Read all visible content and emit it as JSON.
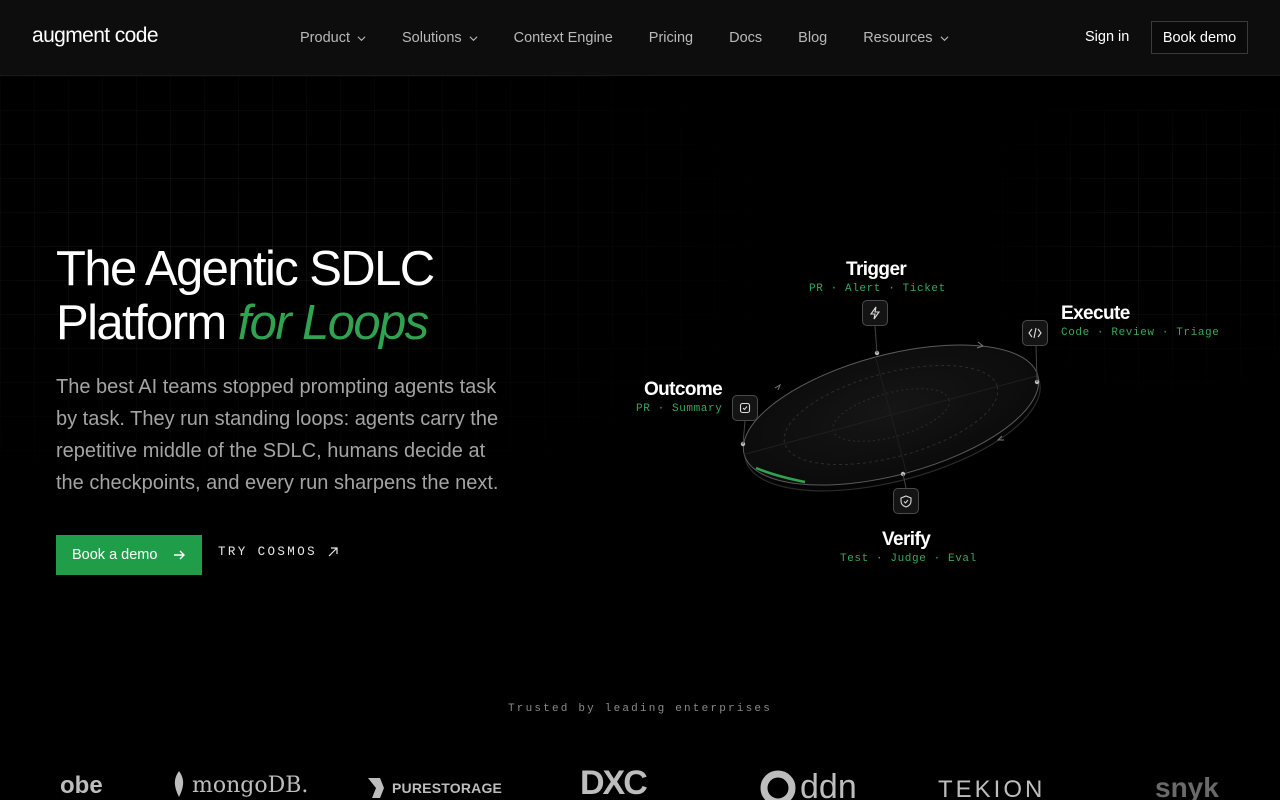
{
  "nav": {
    "brand": "augment code",
    "links": [
      {
        "label": "Product",
        "has_dropdown": true
      },
      {
        "label": "Solutions",
        "has_dropdown": true
      },
      {
        "label": "Context Engine",
        "has_dropdown": false
      },
      {
        "label": "Pricing",
        "has_dropdown": false
      },
      {
        "label": "Docs",
        "has_dropdown": false
      },
      {
        "label": "Blog",
        "has_dropdown": false
      },
      {
        "label": "Resources",
        "has_dropdown": true
      }
    ],
    "sign_in": "Sign in",
    "book_demo": "Book demo"
  },
  "hero": {
    "title_line1": "The Agentic SDLC",
    "title_line2_plain": "Platform",
    "title_line2_accent": "for Loops",
    "subtitle": "The best AI teams stopped prompting agents task by task. They run standing loops: agents carry the repetitive middle of the SDLC, humans decide at the checkpoints, and every run sharpens the next.",
    "cta_primary": "Book a demo",
    "cta_secondary": "TRY COSMOS"
  },
  "loop": {
    "trigger": {
      "title": "Trigger",
      "sub": "PR · Alert · Ticket",
      "icon": "lightning-icon"
    },
    "execute": {
      "title": "Execute",
      "sub": "Code · Review · Triage",
      "icon": "code-icon"
    },
    "verify": {
      "title": "Verify",
      "sub": "Test · Judge · Eval",
      "icon": "shield-icon"
    },
    "outcome": {
      "title": "Outcome",
      "sub": "PR · Summary",
      "icon": "outcome-icon"
    }
  },
  "trusted": {
    "heading": "Trusted by leading enterprises",
    "logos": [
      "obe",
      "mongoDB.",
      "PURESTORAGE",
      "DXC",
      "ddn",
      "TEKION",
      "snyk"
    ]
  },
  "colors": {
    "accent": "#1f9d49",
    "accent_text": "#2fa34f",
    "mono_green": "#35a85a",
    "background": "#000000"
  }
}
